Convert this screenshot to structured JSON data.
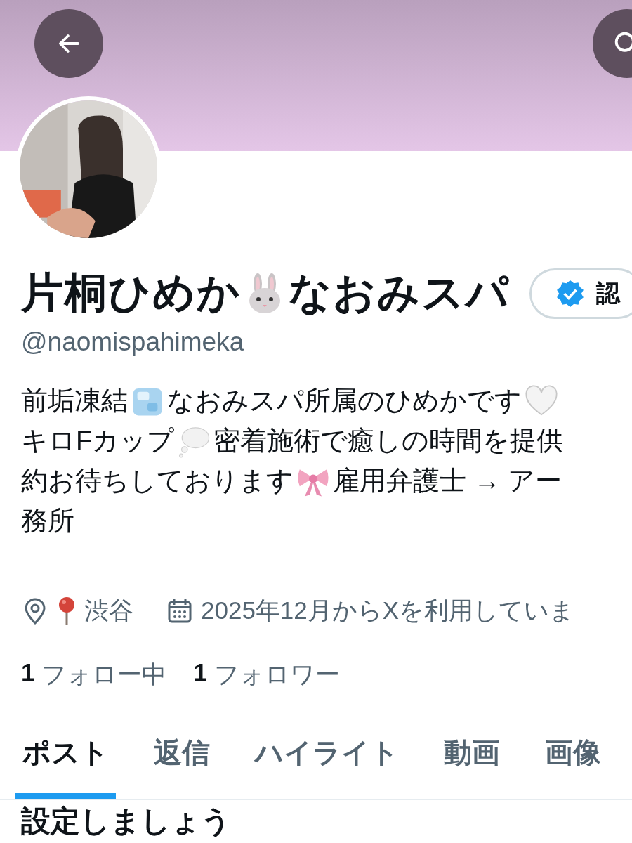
{
  "profile": {
    "name": [
      {
        "kind": "text",
        "text": "片桐ひめか"
      },
      {
        "kind": "rabbit"
      },
      {
        "kind": "text",
        "text": "なおみスパ"
      }
    ],
    "verified_label": "認",
    "handle": "@naomispahimeka",
    "bio": [
      [
        {
          "kind": "text",
          "text": "前垢凍結"
        },
        {
          "kind": "ice"
        },
        {
          "kind": "text",
          "text": "なおみスパ所属のひめかです"
        },
        {
          "kind": "heart"
        }
      ],
      [
        {
          "kind": "text",
          "text": "キロFカップ"
        },
        {
          "kind": "bubble"
        },
        {
          "kind": "text",
          "text": "密着施術で癒しの時間を提供"
        }
      ],
      [
        {
          "kind": "text",
          "text": "約お待ちしております"
        },
        {
          "kind": "bow"
        },
        {
          "kind": "text",
          "text": "雇用弁護士 → アー"
        }
      ],
      [
        {
          "kind": "text",
          "text": "務所"
        }
      ]
    ],
    "location": "渋谷",
    "joined": "2025年12月からXを利用していま",
    "stats": [
      {
        "count": "1",
        "label": "フォロー中"
      },
      {
        "count": "1",
        "label": "フォロワー"
      }
    ]
  },
  "tabs": [
    {
      "label": "ポスト",
      "selected": true
    },
    {
      "label": "返信",
      "selected": false
    },
    {
      "label": "ハイライト",
      "selected": false
    },
    {
      "label": "動画",
      "selected": false
    },
    {
      "label": "画像",
      "selected": false
    }
  ],
  "next_heading": "設定しましょう"
}
